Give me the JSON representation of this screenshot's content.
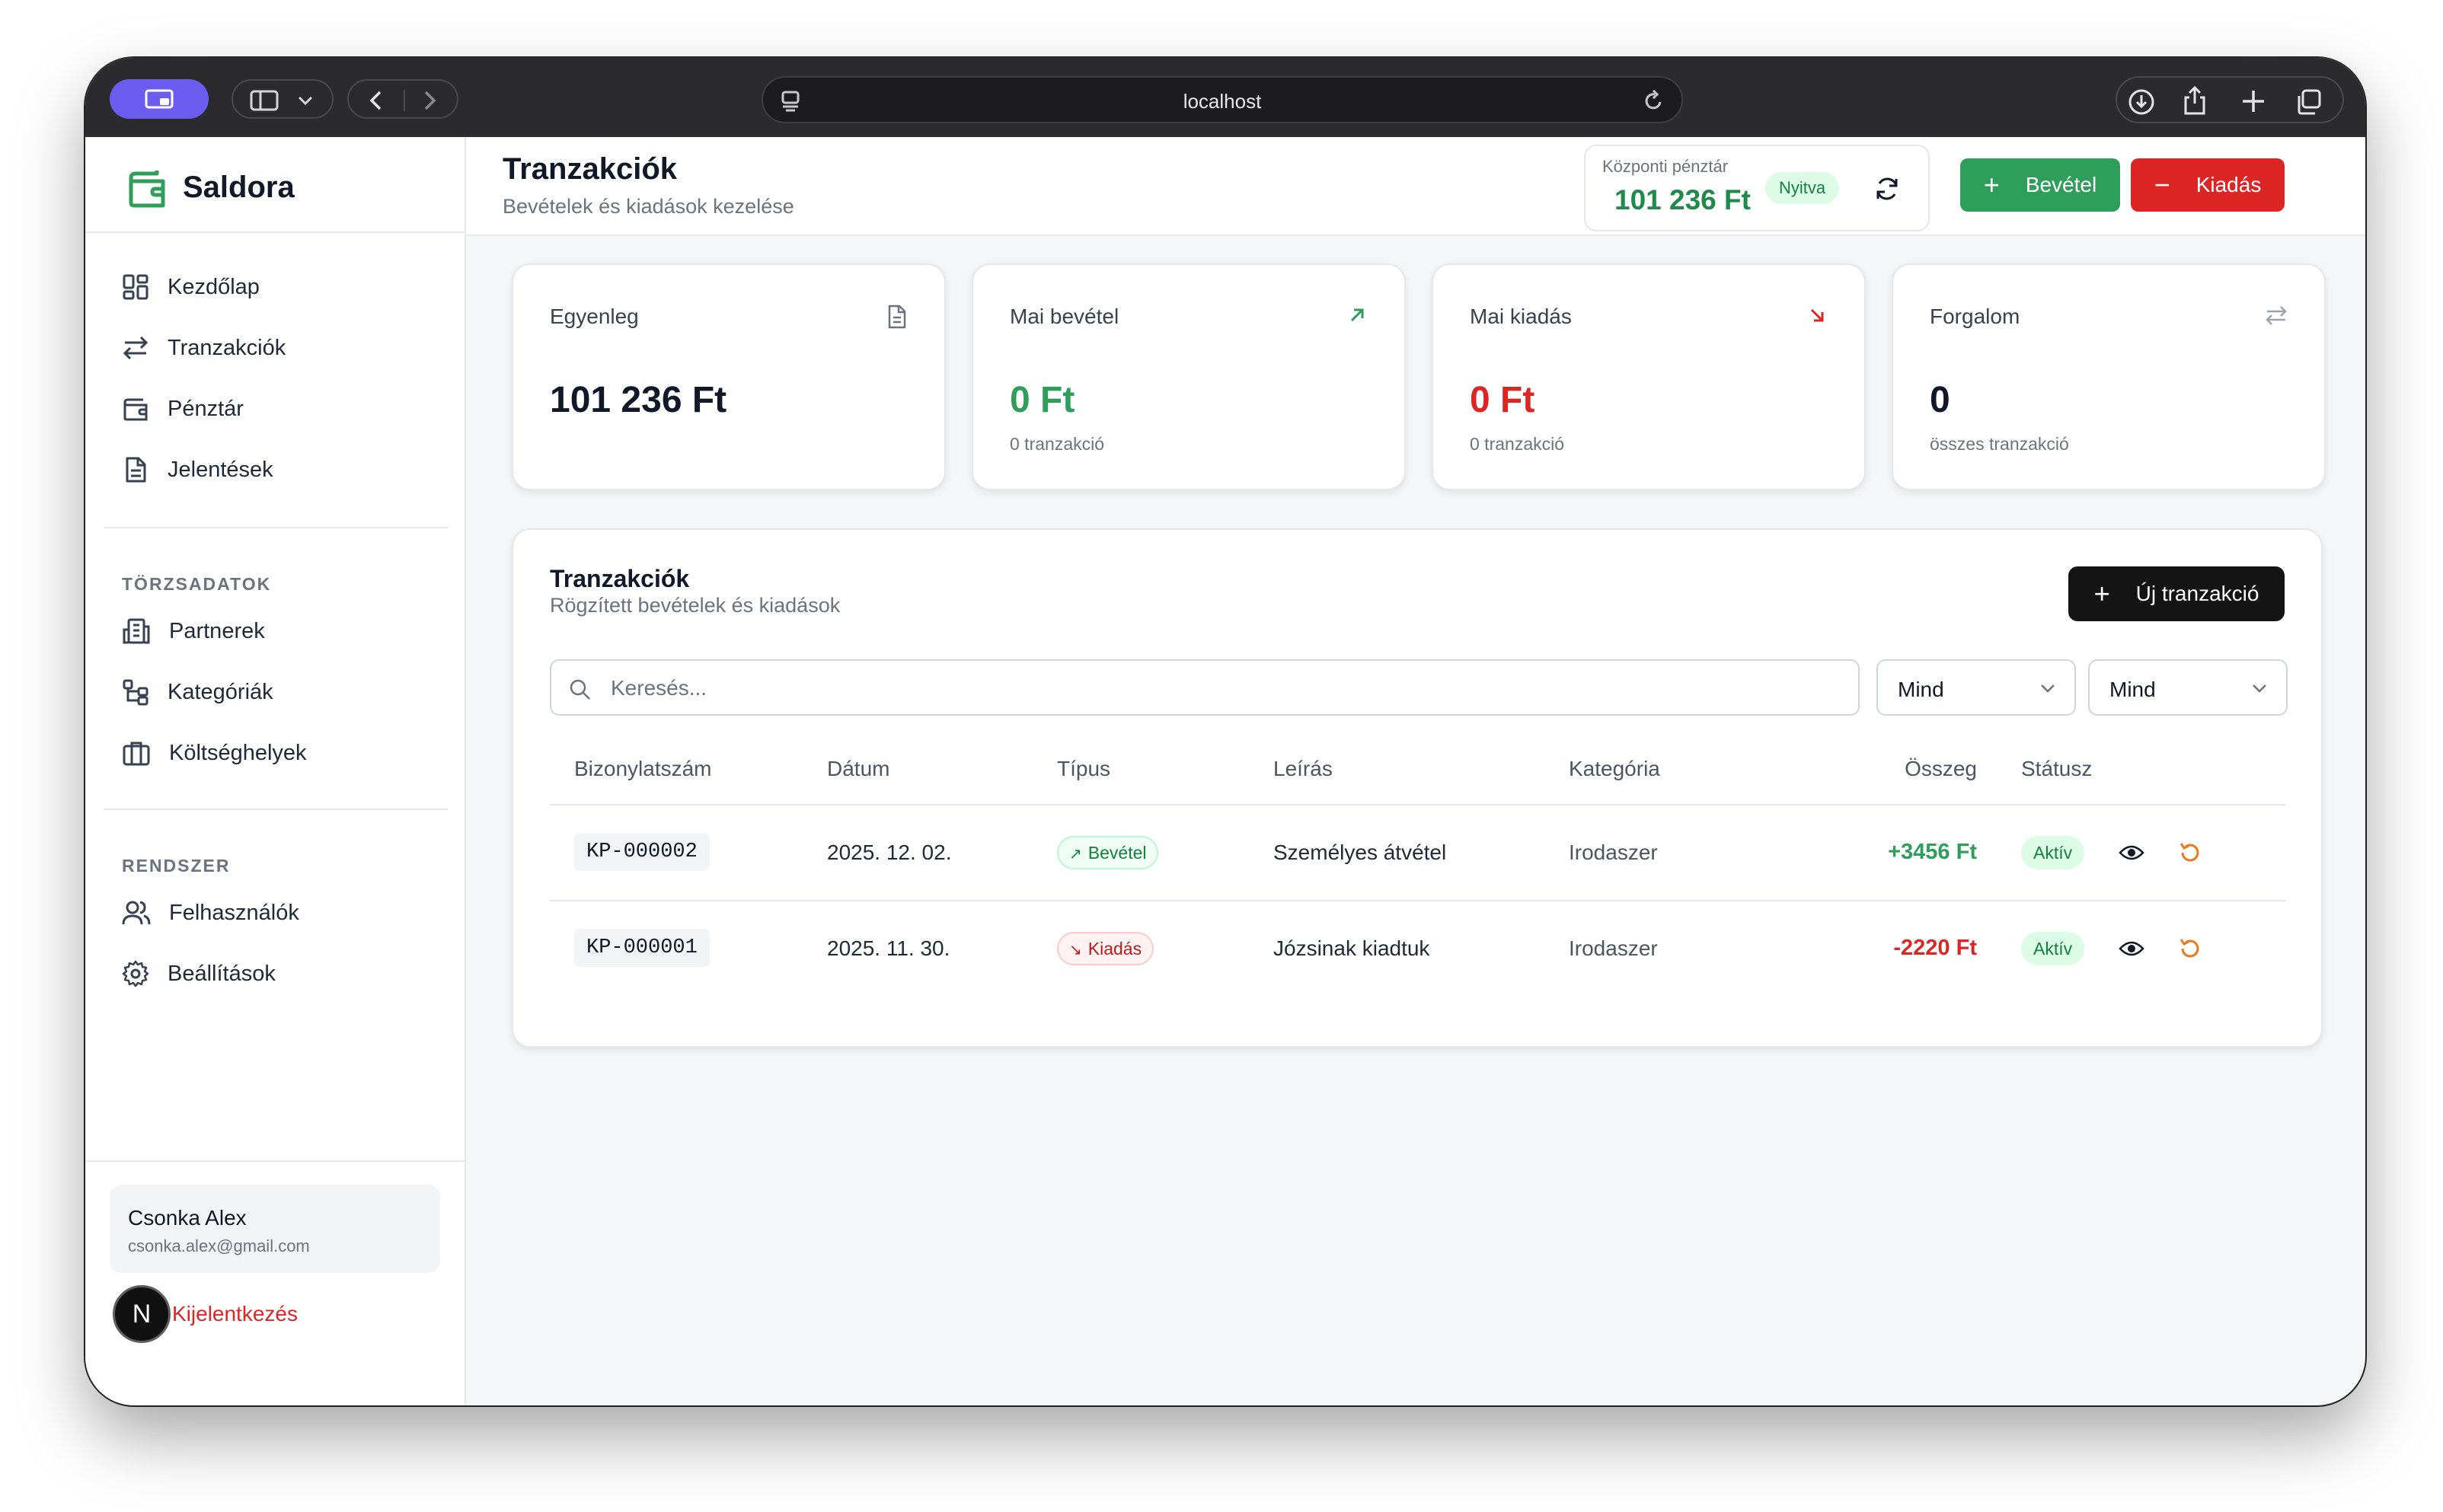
{
  "browser": {
    "url": "localhost"
  },
  "sidebar": {
    "brand": "Saldora",
    "main_items": [
      {
        "label": "Kezdőlap",
        "icon": "dashboard-icon"
      },
      {
        "label": "Tranzakciók",
        "icon": "transfer-arrows-icon"
      },
      {
        "label": "Pénztár",
        "icon": "wallet-icon"
      },
      {
        "label": "Jelentések",
        "icon": "document-icon"
      }
    ],
    "master_title": "TÖRZSADATOK",
    "master_items": [
      {
        "label": "Partnerek",
        "icon": "building-icon"
      },
      {
        "label": "Kategóriák",
        "icon": "tree-icon"
      },
      {
        "label": "Költséghelyek",
        "icon": "briefcase-icon"
      }
    ],
    "system_title": "RENDSZER",
    "system_items": [
      {
        "label": "Felhasználók",
        "icon": "users-icon"
      },
      {
        "label": "Beállítások",
        "icon": "gear-icon"
      }
    ],
    "user": {
      "name": "Csonka Alex",
      "email": "csonka.alex@gmail.com"
    },
    "logout": "Kijelentkezés",
    "badge": "N"
  },
  "header": {
    "title": "Tranzakciók",
    "subtitle": "Bevételek és kiadások kezelése",
    "cashbox": {
      "label": "Központi pénztár",
      "amount": "101 236 Ft",
      "status": "Nyitva"
    },
    "income_button": "Bevétel",
    "expense_button": "Kiadás"
  },
  "stats": [
    {
      "title": "Egyenleg",
      "value": "101 236 Ft",
      "sub": "",
      "icon": "document-icon"
    },
    {
      "title": "Mai bevétel",
      "value": "0 Ft",
      "sub": "0 tranzakció",
      "icon": "arrow-up-right-icon"
    },
    {
      "title": "Mai kiadás",
      "value": "0 Ft",
      "sub": "0 tranzakció",
      "icon": "arrow-down-right-icon"
    },
    {
      "title": "Forgalom",
      "value": "0",
      "sub": "összes tranzakció",
      "icon": "swap-arrows-icon"
    }
  ],
  "transactions": {
    "title": "Tranzakciók",
    "subtitle": "Rögzített bevételek és kiadások",
    "new_button": "Új tranzakció",
    "search_placeholder": "Keresés...",
    "filter_type": "Mind",
    "filter_status": "Mind",
    "columns": [
      "Bizonylatszám",
      "Dátum",
      "Típus",
      "Leírás",
      "Kategória",
      "Összeg",
      "Státusz"
    ],
    "rows": [
      {
        "code": "KP-000002",
        "date": "2025. 12. 02.",
        "type": "Bevétel",
        "description": "Személyes átvétel",
        "category": "Irodaszer",
        "amount": "+3456 Ft",
        "status": "Aktív"
      },
      {
        "code": "KP-000001",
        "date": "2025. 11. 30.",
        "type": "Kiadás",
        "description": "Józsinak kiadtuk",
        "category": "Irodaszer",
        "amount": "-2220 Ft",
        "status": "Aktív"
      }
    ]
  },
  "colors": {
    "income": "#2f9e5b",
    "expense": "#dc2626",
    "accent": "#6d5cf0"
  }
}
